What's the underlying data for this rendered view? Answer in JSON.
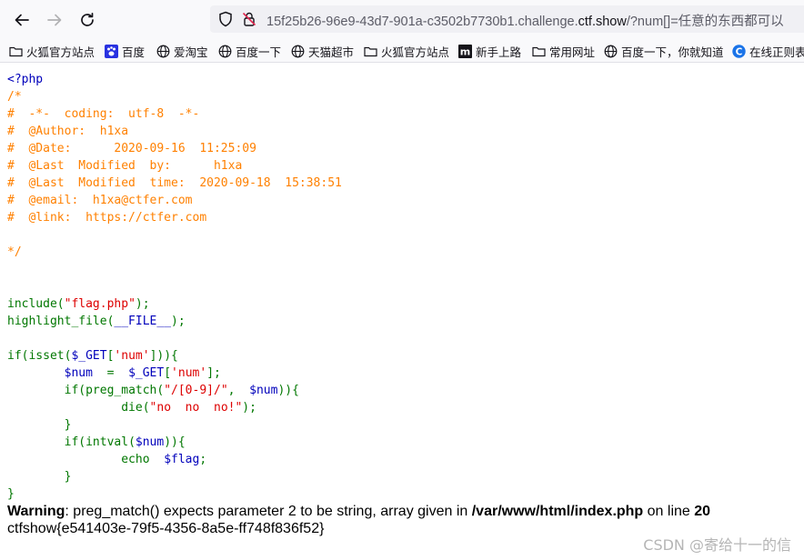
{
  "browser": {
    "url_prefix": "15f25b26-96e9-43d7-901a-c3502b7730b1.challenge.",
    "url_host": "ctf.show",
    "url_suffix": "/?num[]=任意的东西都可以",
    "bookmarks": [
      {
        "label": "火狐官方站点",
        "icon": "folder-icon"
      },
      {
        "label": "百度",
        "icon": "baidu-paw-icon"
      },
      {
        "label": "爱淘宝",
        "icon": "globe-icon"
      },
      {
        "label": "百度一下",
        "icon": "globe-icon"
      },
      {
        "label": "天猫超市",
        "icon": "globe-icon"
      },
      {
        "label": "火狐官方站点",
        "icon": "folder-icon"
      },
      {
        "label": "新手上路",
        "icon": "m-logo-icon"
      },
      {
        "label": "常用网址",
        "icon": "folder-icon"
      },
      {
        "label": "百度一下，你就知道",
        "icon": "globe-icon"
      },
      {
        "label": "在线正则表",
        "icon": "c-logo-icon"
      }
    ]
  },
  "code": {
    "open_tag": "<?php",
    "comment_lines": [
      "/*",
      "#  -*-  coding:  utf-8  -*-",
      "#  @Author:  h1xa",
      "#  @Date:      2020-09-16  11:25:09",
      "#  @Last  Modified  by:      h1xa",
      "#  @Last  Modified  time:  2020-09-18  15:38:51",
      "#  @email:  h1xa@ctfer.com",
      "#  @link:  https://ctfer.com",
      "",
      "*/"
    ],
    "tokens": {
      "include": "include(",
      "flag_file": "\"flag.php\"",
      "close_semi": ");",
      "highlight_open": "highlight_file(",
      "file_const": "__FILE__",
      "if_isset": "if(isset(",
      "get_var": "$_GET",
      "bracket_open": "[",
      "num_key": "'num'",
      "bracket_close_if": "])){",
      "indent8": "        ",
      "indent16": "                ",
      "num_var": "$num",
      "assign": "  =  ",
      "bracket_close_semi": "];",
      "preg_open": "if(preg_match(",
      "regex": "\"/[0-9]/\"",
      "comma": ",  ",
      "close_brace_if": ")){",
      "die_open": "die(",
      "no_msg": "\"no  no  no!\"",
      "close_brace": "}",
      "intval_open": "if(intval(",
      "echo_kw": "echo  ",
      "flag_var": "$flag",
      "semi": ";"
    }
  },
  "warning": {
    "label": "Warning",
    "message": ": preg_match() expects parameter 2 to be string, array given in ",
    "path": "/var/www/html/index.php",
    "on_line": " on line ",
    "line_no": "20"
  },
  "flag_output": "ctfshow{e541403e-79f5-4356-8a5e-ff748f836f52}",
  "watermark": "CSDN @寄给十一的信"
}
